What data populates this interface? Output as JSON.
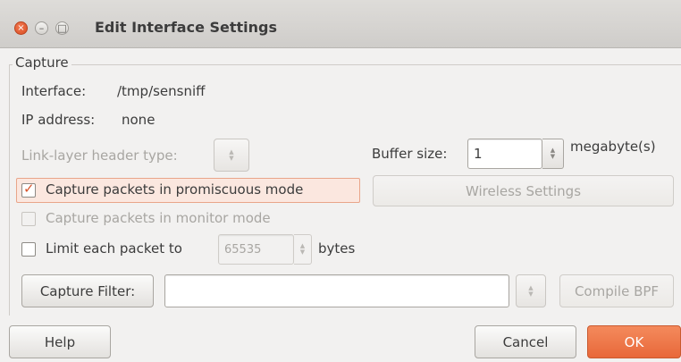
{
  "window": {
    "title": "Edit Interface Settings",
    "close_glyph": "×",
    "minimize_glyph": "–",
    "maximize_glyph": "□"
  },
  "capture": {
    "frame_label": "Capture",
    "interface_label": "Interface:",
    "interface_value": "/tmp/sensniff",
    "ip_label": "IP address:",
    "ip_value": "none",
    "link_layer_label": "Link-layer header type:",
    "buffer_label": "Buffer size:",
    "buffer_value": "1",
    "buffer_unit": "megabyte(s)",
    "promiscuous_label": "Capture packets in promiscuous mode",
    "promiscuous_checked": true,
    "monitor_label": "Capture packets in monitor mode",
    "monitor_checked": false,
    "wireless_settings_label": "Wireless Settings",
    "limit_label": "Limit each packet to",
    "limit_value": "65535",
    "limit_unit": "bytes",
    "limit_checked": false,
    "capture_filter_label": "Capture Filter:",
    "capture_filter_value": "",
    "compile_bpf_label": "Compile BPF"
  },
  "footer": {
    "help_label": "Help",
    "cancel_label": "Cancel",
    "ok_label": "OK"
  },
  "colors": {
    "accent": "#e8683a",
    "check": "#d8542c",
    "window_bg": "#f2f1f0"
  }
}
